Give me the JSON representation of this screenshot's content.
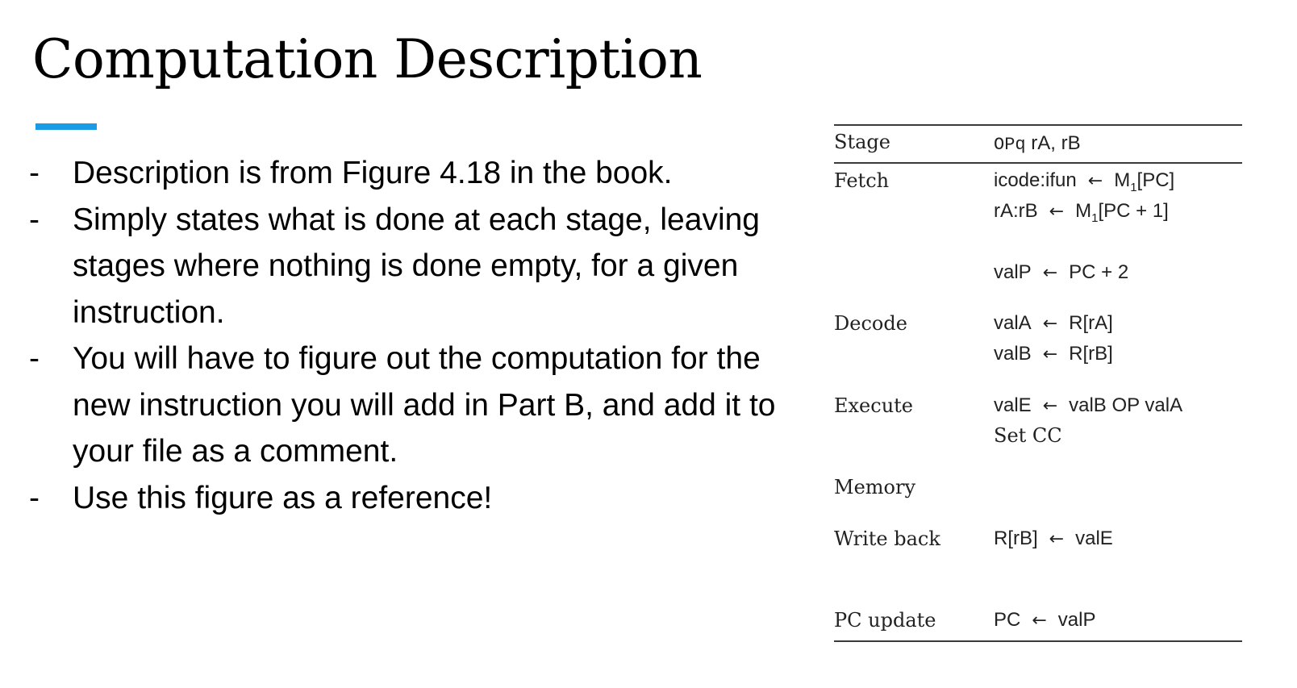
{
  "title": "Computation Description",
  "accent_color": "#1a9be6",
  "bullets": [
    {
      "dash": "-",
      "text": "Description is from Figure 4.18 in the book."
    },
    {
      "dash": "-",
      "text": "Simply states what is done at each stage, leaving stages where nothing is done empty, for a given instruction."
    },
    {
      "dash": "-",
      "text": "You will have to figure out the computation for the new instruction you will add in Part B, and add it to your file as a comment."
    },
    {
      "dash": "-",
      "text": "Use this figure as a reference!"
    }
  ],
  "figure": {
    "header": {
      "stage": "Stage",
      "op": "OPq",
      "operands": " rA, rB"
    },
    "arrow": "←",
    "rows": {
      "fetch": {
        "stage": "Fetch",
        "l1_left": "icode:ifun",
        "l1_right_a": "M",
        "l1_right_sub": "1",
        "l1_right_b": "[PC]",
        "l2_left": "rA:rB",
        "l2_right_a": "M",
        "l2_right_sub": "1",
        "l2_right_b": "[PC + 1]",
        "l3_left": "valP",
        "l3_right": "PC + 2"
      },
      "decode": {
        "stage": "Decode",
        "l1_left": "valA",
        "l1_right": "R[rA]",
        "l2_left": "valB",
        "l2_right": "R[rB]"
      },
      "execute": {
        "stage": "Execute",
        "l1_left": "valE",
        "l1_right": "valB OP valA",
        "l2": "Set CC"
      },
      "memory": {
        "stage": "Memory"
      },
      "writeback": {
        "stage": "Write back",
        "l1_left": "R[rB]",
        "l1_right": "valE"
      },
      "pcupdate": {
        "stage": "PC update",
        "l1_left": "PC",
        "l1_right": "valP"
      }
    }
  }
}
